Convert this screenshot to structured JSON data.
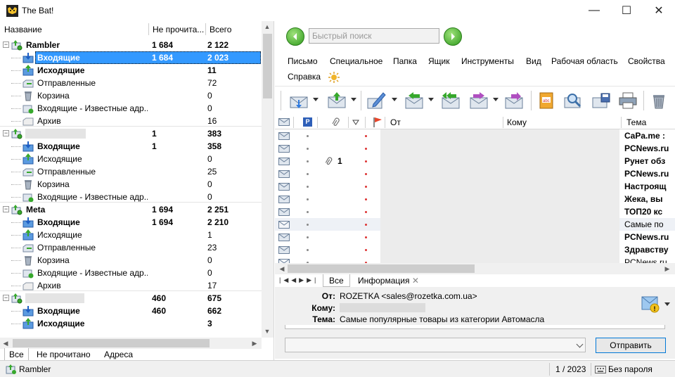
{
  "window": {
    "title": "The Bat!",
    "min": "—",
    "max": "☐",
    "close": "✕"
  },
  "folders": {
    "headers": {
      "name": "Название",
      "unread": "Не прочита...",
      "total": "Всего"
    },
    "rows": [
      {
        "name": "Rambler",
        "unread": "1 684",
        "total": "2 122",
        "bold": true,
        "level": 0
      },
      {
        "name": "Входящие",
        "unread": "1 684",
        "total": "2 023",
        "bold": true,
        "level": 1,
        "selected": true
      },
      {
        "name": "Исходящие",
        "unread": "",
        "total": "11",
        "bold": true,
        "level": 1
      },
      {
        "name": "Отправленные",
        "unread": "",
        "total": "72",
        "level": 1
      },
      {
        "name": "Корзина",
        "unread": "",
        "total": "0",
        "level": 1
      },
      {
        "name": "Входящие - Известные адр...",
        "unread": "",
        "total": "0",
        "level": 1
      },
      {
        "name": "Архив",
        "unread": "",
        "total": "16",
        "level": 1
      },
      {
        "name": "",
        "unread": "1",
        "total": "383",
        "bold": true,
        "level": 0
      },
      {
        "name": "Входящие",
        "unread": "1",
        "total": "358",
        "bold": true,
        "level": 1
      },
      {
        "name": "Исходящие",
        "unread": "",
        "total": "0",
        "level": 1
      },
      {
        "name": "Отправленные",
        "unread": "",
        "total": "25",
        "level": 1
      },
      {
        "name": "Корзина",
        "unread": "",
        "total": "0",
        "level": 1
      },
      {
        "name": "Входящие - Известные адр...",
        "unread": "",
        "total": "0",
        "level": 1
      },
      {
        "name": "Meta",
        "unread": "1 694",
        "total": "2 251",
        "bold": true,
        "level": 0
      },
      {
        "name": "Входящие",
        "unread": "1 694",
        "total": "2 210",
        "bold": true,
        "level": 1
      },
      {
        "name": "Исходящие",
        "unread": "",
        "total": "1",
        "level": 1
      },
      {
        "name": "Отправленные",
        "unread": "",
        "total": "23",
        "level": 1
      },
      {
        "name": "Корзина",
        "unread": "",
        "total": "0",
        "level": 1
      },
      {
        "name": "Входящие - Известные адр...",
        "unread": "",
        "total": "0",
        "level": 1
      },
      {
        "name": "Архив",
        "unread": "",
        "total": "17",
        "level": 1
      },
      {
        "name": "",
        "unread": "460",
        "total": "675",
        "bold": true,
        "level": 0
      },
      {
        "name": "Входящие",
        "unread": "460",
        "total": "662",
        "bold": true,
        "level": 1
      },
      {
        "name": "Исходящие",
        "unread": "",
        "total": "3",
        "bold": true,
        "level": 1
      }
    ],
    "tabs": [
      "Все",
      "Не прочитано",
      "Адреса"
    ]
  },
  "search": {
    "placeholder": "Быстрый поиск"
  },
  "menu": [
    "Письмо",
    "Специальное",
    "Папка",
    "Ящик",
    "Инструменты",
    "Вид",
    "Рабочая область",
    "Свойства",
    "Справка"
  ],
  "messages": {
    "headers": {
      "from": "От",
      "to": "Кому",
      "subject": "Тема"
    },
    "rows": [
      {
        "subject": "CaPa.me :",
        "bold": true
      },
      {
        "subject": "PCNews.ru",
        "bold": true
      },
      {
        "subject": "Рунет обз",
        "bold": true,
        "attach": "1"
      },
      {
        "subject": "PCNews.ru",
        "bold": true
      },
      {
        "subject": "Настроящ",
        "bold": true
      },
      {
        "subject": "Жека, вы",
        "bold": true
      },
      {
        "subject": "ТОП20 кс",
        "bold": true
      },
      {
        "subject": "Самые по",
        "bold": false
      },
      {
        "subject": "PCNews.ru",
        "bold": true
      },
      {
        "subject": "Здравству",
        "bold": true
      },
      {
        "subject": "PCNews.ru",
        "bold": false
      }
    ]
  },
  "preview_tabs": [
    "Все",
    "Информация"
  ],
  "preview": {
    "from_label": "От:",
    "from_value": "ROZETKA <sales@rozetka.com.ua>",
    "to_label": "Кому:",
    "subject_label": "Тема:",
    "subject_value": "Самые популярные товары из категории Автомасла"
  },
  "reply": {
    "send": "Отправить"
  },
  "status": {
    "account": "Rambler",
    "count": "1 / 2023",
    "password": "Без пароля"
  }
}
